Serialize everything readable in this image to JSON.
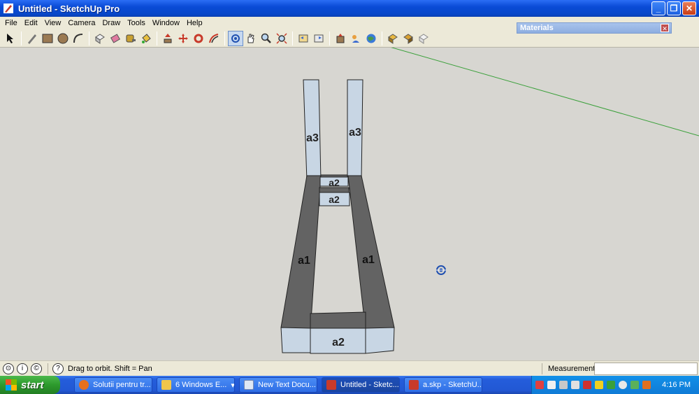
{
  "window": {
    "title": "Untitled - SketchUp Pro"
  },
  "menu": [
    "File",
    "Edit",
    "View",
    "Camera",
    "Draw",
    "Tools",
    "Window",
    "Help"
  ],
  "materials_panel": {
    "title": "Materials"
  },
  "model_labels": {
    "left_post": "a3",
    "right_post": "a3",
    "top_rail": "a2",
    "mid_rail": "a2",
    "left_side": "a1",
    "right_side": "a1",
    "front": "a2"
  },
  "status": {
    "hint": "Drag to orbit.  Shift = Pan",
    "measurements_label": "Measurements",
    "measurements_value": ""
  },
  "taskbar": {
    "start_label": "start",
    "tasks": [
      {
        "label": "Solutii pentru tr...",
        "icon": "firefox-icon",
        "color": "#e6701e"
      },
      {
        "label": "6 Windows E...",
        "icon": "folder-icon",
        "color": "#f1c64b"
      },
      {
        "label": "New Text Docu...",
        "icon": "notepad-icon",
        "color": "#dfe8f5"
      },
      {
        "label": "Untitled - Sketc...",
        "icon": "sketchup-icon",
        "color": "#c83a2a"
      },
      {
        "label": "a.skp - SketchU...",
        "icon": "sketchup-icon",
        "color": "#c83a2a"
      }
    ],
    "clock": "4:16 PM"
  }
}
